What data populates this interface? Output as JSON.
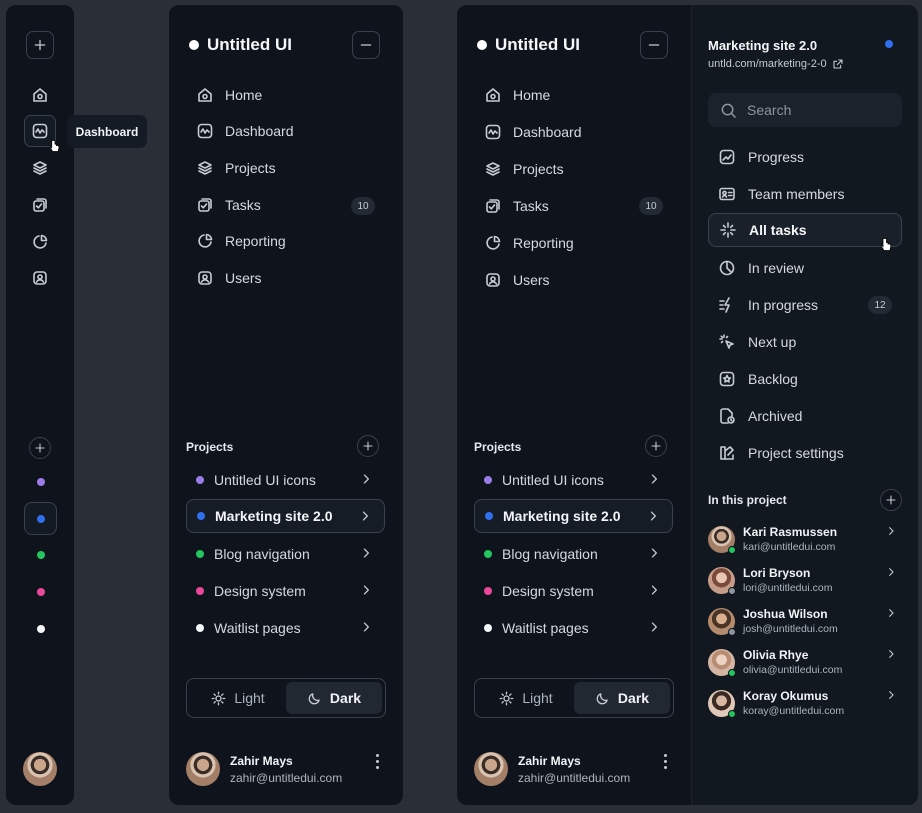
{
  "brand": {
    "name": "Untitled UI"
  },
  "tooltip": {
    "label": "Dashboard"
  },
  "nav": {
    "items": [
      {
        "label": "Home",
        "icon": "home-icon"
      },
      {
        "label": "Dashboard",
        "icon": "activity-icon"
      },
      {
        "label": "Projects",
        "icon": "layers-icon"
      },
      {
        "label": "Tasks",
        "icon": "check-square-icon",
        "badge": "10"
      },
      {
        "label": "Reporting",
        "icon": "pie-chart-icon"
      },
      {
        "label": "Users",
        "icon": "user-square-icon"
      }
    ]
  },
  "projects": {
    "title": "Projects",
    "items": [
      {
        "label": "Untitled UI icons",
        "color": "#9b7be8"
      },
      {
        "label": "Marketing site 2.0",
        "color": "#2f6fed"
      },
      {
        "label": "Blog navigation",
        "color": "#22c55e"
      },
      {
        "label": "Design system",
        "color": "#ec4899"
      },
      {
        "label": "Waitlist pages",
        "color": "#f5f6f8"
      }
    ]
  },
  "theme": {
    "light": "Light",
    "dark": "Dark",
    "selected": "Dark"
  },
  "user": {
    "name": "Zahir Mays",
    "email": "zahir@untitledui.com"
  },
  "detail": {
    "title": "Marketing site 2.0",
    "url": "untld.com/marketing-2-0",
    "status_color": "#2f6fed",
    "search_placeholder": "Search",
    "menu": [
      {
        "label": "Progress",
        "icon": "chart-icon"
      },
      {
        "label": "Team members",
        "icon": "id-card-icon"
      },
      {
        "label": "All tasks",
        "icon": "sparkles-icon"
      },
      {
        "label": "In review",
        "icon": "clock-pie-icon"
      },
      {
        "label": "In progress",
        "icon": "bolt-lines-icon",
        "badge": "12"
      },
      {
        "label": "Next up",
        "icon": "cursor-click-icon"
      },
      {
        "label": "Backlog",
        "icon": "star-box-icon"
      },
      {
        "label": "Archived",
        "icon": "file-clock-icon"
      },
      {
        "label": "Project settings",
        "icon": "settings-layout-icon"
      }
    ],
    "members_title": "In this project",
    "members": [
      {
        "name": "Kari Rasmussen",
        "email": "kari@untitledui.com",
        "online": true
      },
      {
        "name": "Lori Bryson",
        "email": "lori@untitledui.com",
        "online": false
      },
      {
        "name": "Joshua Wilson",
        "email": "josh@untitledui.com",
        "online": false
      },
      {
        "name": "Olivia Rhye",
        "email": "olivia@untitledui.com",
        "online": true
      },
      {
        "name": "Koray Okumus",
        "email": "koray@untitledui.com",
        "online": true
      }
    ]
  }
}
